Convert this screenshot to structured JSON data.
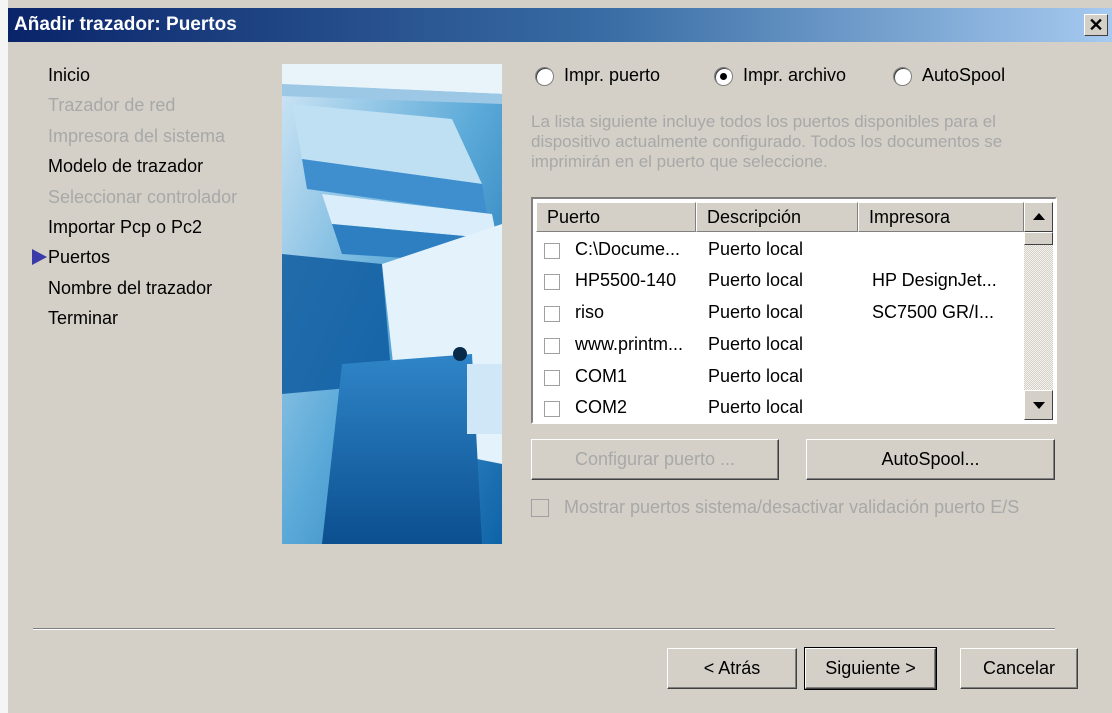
{
  "window": {
    "title": "Añadir trazador: Puertos",
    "close_glyph": "✕"
  },
  "nav": {
    "items": [
      {
        "label": "Inicio",
        "enabled": true
      },
      {
        "label": "Trazador de red",
        "enabled": false
      },
      {
        "label": "Impresora del sistema",
        "enabled": false
      },
      {
        "label": "Modelo de trazador",
        "enabled": true
      },
      {
        "label": "Seleccionar controlador",
        "enabled": false
      },
      {
        "label": "Importar Pcp o Pc2",
        "enabled": true
      },
      {
        "label": "Puertos",
        "enabled": true,
        "current": true
      },
      {
        "label": "Nombre del trazador",
        "enabled": true
      },
      {
        "label": "Terminar",
        "enabled": true
      }
    ],
    "current_marker_icon": "arrow-right-icon"
  },
  "port_mode": {
    "options": [
      {
        "label": "Impr. puerto",
        "selected": false
      },
      {
        "label": "Impr. archivo",
        "selected": true
      },
      {
        "label": "AutoSpool",
        "selected": false
      }
    ]
  },
  "description": "La lista siguiente incluye todos los puertos disponibles para el dispositivo actualmente configurado. Todos los documentos se imprimirán en el puerto que seleccione.",
  "ports_table": {
    "columns": [
      "Puerto",
      "Descripción",
      "Impresora"
    ],
    "rows": [
      {
        "port": "C:\\Docume...",
        "description": "Puerto local",
        "printer": ""
      },
      {
        "port": "HP5500-140",
        "description": "Puerto local",
        "printer": "HP DesignJet..."
      },
      {
        "port": "riso",
        "description": "Puerto local",
        "printer": "SC7500 GR/I..."
      },
      {
        "port": "www.printm...",
        "description": "Puerto local",
        "printer": ""
      },
      {
        "port": "COM1",
        "description": "Puerto local",
        "printer": ""
      },
      {
        "port": "COM2",
        "description": "Puerto local",
        "printer": ""
      }
    ]
  },
  "buttons": {
    "configure_port": "Configurar puerto ...",
    "autospool": "AutoSpool...",
    "back": "< Atrás",
    "next": "Siguiente >",
    "cancel": "Cancelar"
  },
  "show_system_ports": {
    "label": "Mostrar puertos sistema/desactivar validación puerto E/S",
    "checked": false,
    "enabled": false
  },
  "colors": {
    "title_gradient_start": "#0a246a",
    "title_gradient_end": "#a6caf0",
    "dialog_bg": "#d4d0c8",
    "disabled_text": "#a8a8a8",
    "nav_marker": "#3a3aa8"
  }
}
